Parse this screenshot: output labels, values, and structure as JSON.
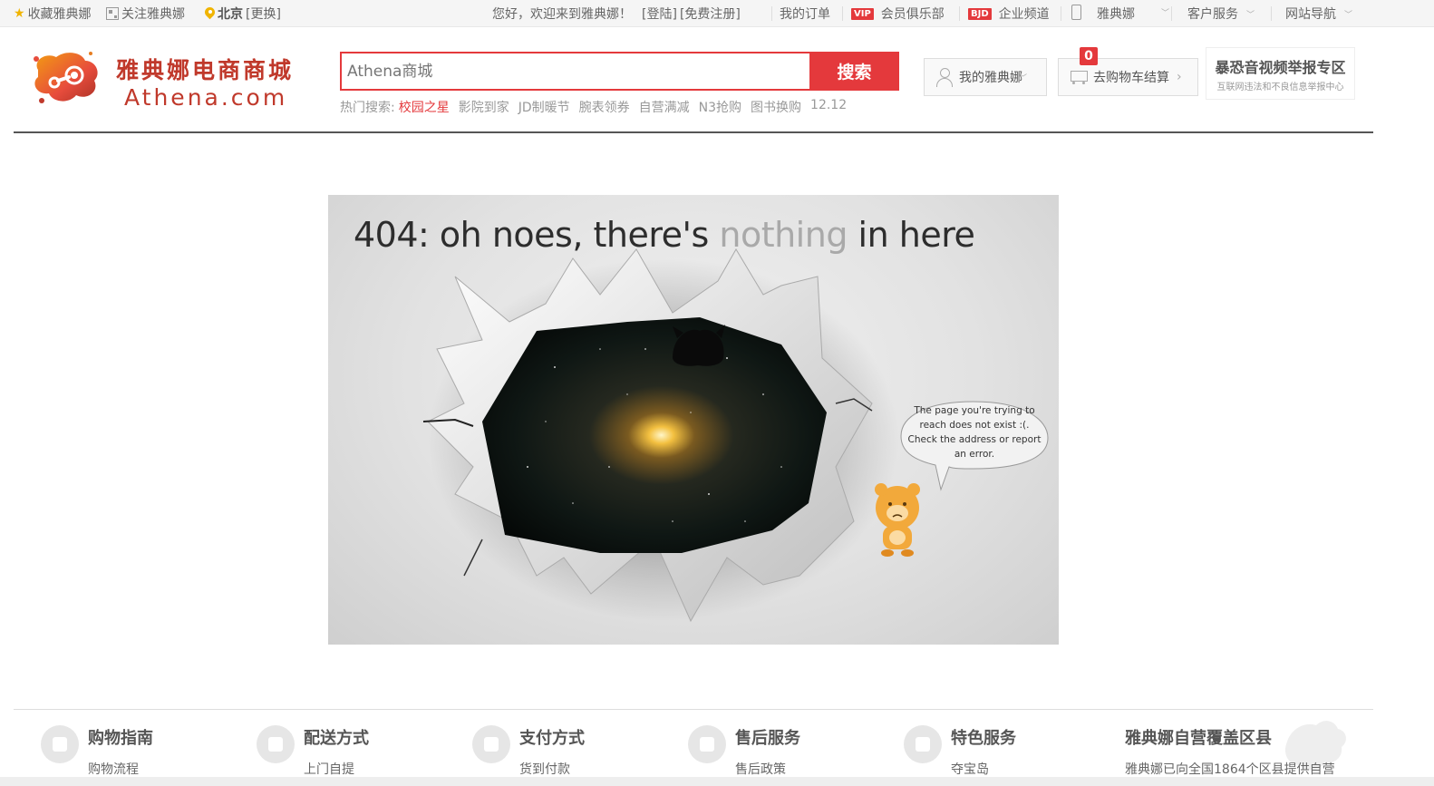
{
  "topbar": {
    "fav": "收藏雅典娜",
    "follow": "关注雅典娜",
    "city": "北京",
    "change_city": "[更换]",
    "welcome": "您好，欢迎来到雅典娜！",
    "login": "[登陆]",
    "register": "[免费注册]",
    "orders": "我的订单",
    "vip_badge": "VIP",
    "vip": "会员俱乐部",
    "bjd_badge": "BJD",
    "enterprise": "企业频道",
    "mobile": "雅典娜",
    "service": "客户服务",
    "sitenav": "网站导航"
  },
  "logo": {
    "cn": "雅典娜电商商城",
    "en": "Athena.com"
  },
  "search": {
    "placeholder": "Athena商城",
    "button": "搜索"
  },
  "hot": {
    "label": "热门搜索:",
    "items": [
      "校园之星",
      "影院到家",
      "JD制暖节",
      "腕表领券",
      "自营满减",
      "N3抢购",
      "图书换购",
      "12.12"
    ]
  },
  "header": {
    "my_account": "我的雅典娜",
    "cart": "去购物车结算",
    "cart_count": "0",
    "report_title": "暴恐音视频举报专区",
    "report_sub": "互联网违法和不良信息举报中心"
  },
  "error": {
    "title_a": "404: oh noes, there's ",
    "title_b": "nothing",
    "title_c": " in here",
    "bubble": "The page you're trying to reach does not exist :(. Check the address or report an error."
  },
  "footer": [
    {
      "title": "购物指南",
      "sub": "购物流程"
    },
    {
      "title": "配送方式",
      "sub": "上门自提"
    },
    {
      "title": "支付方式",
      "sub": "货到付款"
    },
    {
      "title": "售后服务",
      "sub": "售后政策"
    },
    {
      "title": "特色服务",
      "sub": "夺宝岛"
    },
    {
      "title": "雅典娜自营覆盖区县",
      "sub": "雅典娜已向全国1864个区县提供自营"
    }
  ],
  "colors": {
    "accent": "#e4393c",
    "brand": "#c0392b"
  }
}
